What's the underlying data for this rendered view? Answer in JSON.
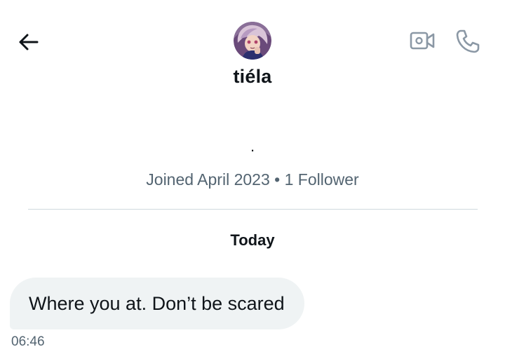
{
  "header": {
    "back_icon": "arrow-left-icon",
    "video_icon": "video-camera-icon",
    "call_icon": "phone-icon",
    "display_name": "tiéla"
  },
  "profile": {
    "bio": ".",
    "joined": "Joined April 2023",
    "separator": "•",
    "followers": "1 Follower"
  },
  "conversation": {
    "date_label": "Today",
    "messages": [
      {
        "text": "Where you at. Don’t be scared",
        "time": "06:46"
      }
    ]
  },
  "colors": {
    "text_primary": "#0f1419",
    "text_secondary": "#536471",
    "icon_muted": "#8b98a5",
    "bubble_background": "#eff3f4",
    "divider": "#cfd9de"
  }
}
